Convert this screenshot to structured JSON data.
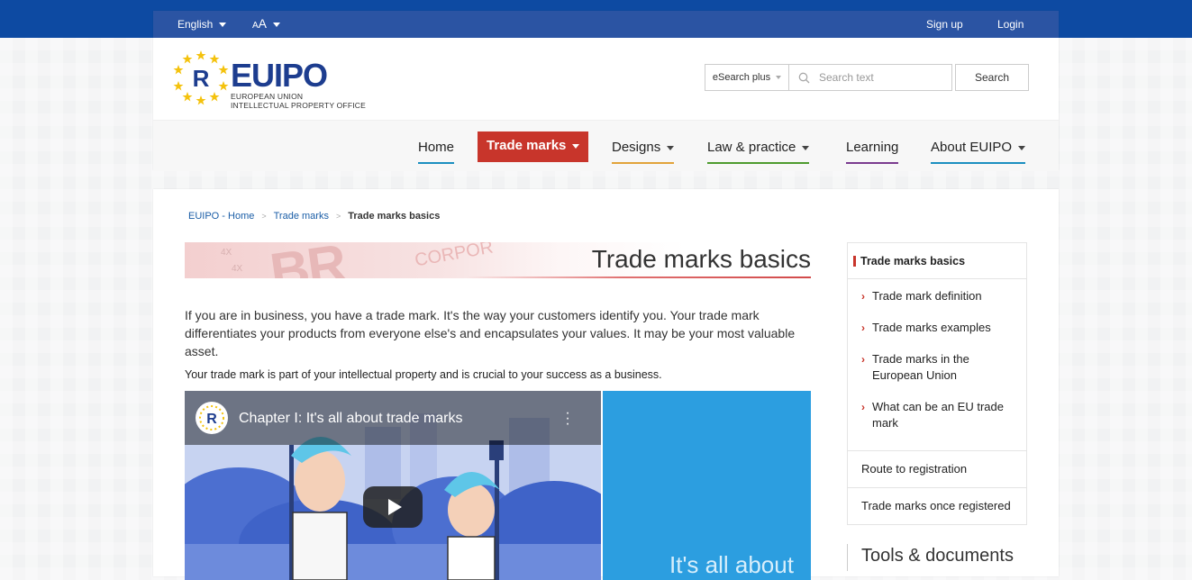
{
  "util": {
    "language": "English",
    "font_size": "AA",
    "signup": "Sign up",
    "login": "Login"
  },
  "logo": {
    "text": "EUIPO",
    "sub1": "EUROPEAN UNION",
    "sub2": "INTELLECTUAL PROPERTY OFFICE"
  },
  "search": {
    "scope": "eSearch plus",
    "placeholder": "Search text",
    "button": "Search"
  },
  "nav": {
    "items": [
      {
        "label": "Home",
        "color": "#1b8fc0"
      },
      {
        "label": "Trade marks",
        "color": "#c8352b"
      },
      {
        "label": "Designs",
        "color": "#e2a33a"
      },
      {
        "label": "Law & practice",
        "color": "#4e9b2e"
      },
      {
        "label": "Learning",
        "color": "#7a3b8f"
      },
      {
        "label": "About EUIPO",
        "color": "#1b8fc0"
      }
    ]
  },
  "breadcrumb": {
    "home": "EUIPO - Home",
    "section": "Trade marks",
    "current": "Trade marks basics"
  },
  "page": {
    "title": "Trade marks basics",
    "intro": "If you are in business, you have a trade mark. It's the way your customers identify you. Your trade mark differentiates your products from everyone else's and encapsulates your values. It may be your most valuable asset.",
    "intro2": "Your trade mark is part of your intellectual property and is crucial to your success as a business."
  },
  "video": {
    "title": "Chapter I: It's all about trade marks",
    "side_text": "It's all about"
  },
  "sidenav": {
    "title": "Trade marks basics",
    "sub_items": [
      "Trade mark definition",
      "Trade marks examples",
      "Trade marks in the European Union",
      "What can be an EU trade mark"
    ],
    "links": [
      "Route to registration",
      "Trade marks once registered"
    ]
  },
  "tools_title": "Tools & documents"
}
